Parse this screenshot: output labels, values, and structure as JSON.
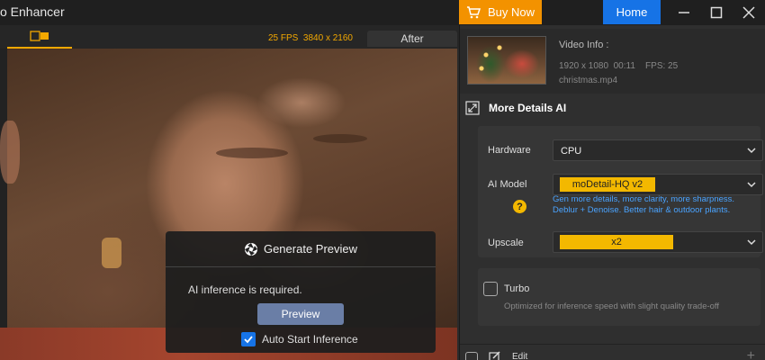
{
  "window": {
    "title": "o Enhancer"
  },
  "titlebar": {
    "buy_label": "Buy Now",
    "home_label": "Home"
  },
  "preview": {
    "fps": "25 FPS",
    "resolution": "3840 x 2160",
    "after_label": "After"
  },
  "modal": {
    "title": "Generate Preview",
    "message": "AI inference is required.",
    "preview_button": "Preview",
    "auto_start_label": "Auto Start Inference",
    "auto_start_checked": true
  },
  "video_info": {
    "title": "Video Info :",
    "resolution": "1920 x 1080",
    "duration": "00:11",
    "fps": "FPS: 25",
    "filename": "christmas.mp4"
  },
  "section": {
    "title": "More Details AI"
  },
  "settings": {
    "hardware_label": "Hardware",
    "hardware_value": "CPU",
    "model_label": "AI Model",
    "model_value": "moDetail-HQ  v2",
    "model_desc": "Gen more details, more clarity, more sharpness. Deblur + Denoise. Better hair & outdoor plants.",
    "help_symbol": "?",
    "upscale_label": "Upscale",
    "upscale_value": "x2"
  },
  "turbo": {
    "label": "Turbo",
    "desc": "Optimized for inference speed with slight quality trade-off"
  },
  "edit": {
    "label": "Edit",
    "plus": "+"
  },
  "colors": {
    "accent_orange": "#f39200",
    "accent_blue": "#1673e6",
    "highlight_yellow": "#f3b800",
    "link_blue": "#4aa3ff"
  }
}
